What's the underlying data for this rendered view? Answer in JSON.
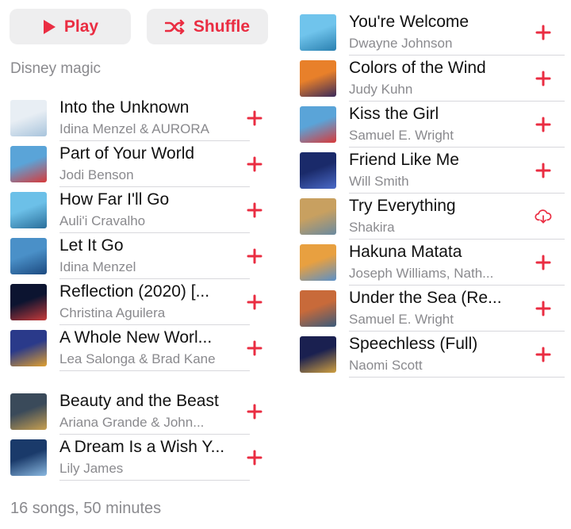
{
  "buttons": {
    "play_label": "Play",
    "shuffle_label": "Shuffle"
  },
  "description": "Disney magic",
  "left_songs": [
    {
      "title": "Into the Unknown",
      "artist": "Idina Menzel & AURORA",
      "art": [
        "#e8eef4",
        "#a8c4dc"
      ],
      "action": "add"
    },
    {
      "title": "Part of Your World",
      "artist": "Jodi Benson",
      "art": [
        "#5aa4d8",
        "#d83a3a"
      ],
      "action": "add"
    },
    {
      "title": "How Far I'll Go",
      "artist": "Auli'i Cravalho",
      "art": [
        "#6cc0e8",
        "#2a6e9a"
      ],
      "action": "add"
    },
    {
      "title": "Let It Go",
      "artist": "Idina Menzel",
      "art": [
        "#4a90c8",
        "#1c4a80"
      ],
      "action": "add"
    },
    {
      "title": "Reflection (2020) [...",
      "artist": "Christina Aguilera",
      "art": [
        "#0c1430",
        "#c83a3a"
      ],
      "action": "add"
    },
    {
      "title": "A Whole New Worl...",
      "artist": "Lea Salonga & Brad Kane",
      "art": [
        "#2a3a8a",
        "#e0a030"
      ],
      "action": "add"
    }
  ],
  "left_songs_more": [
    {
      "title": "Beauty and the Beast",
      "artist": "Ariana Grande & John...",
      "art": [
        "#3a4a5a",
        "#c8a050"
      ],
      "action": "add"
    },
    {
      "title": "A Dream Is a Wish Y...",
      "artist": "Lily James",
      "art": [
        "#1a3a6a",
        "#8ab8e0"
      ],
      "action": "add"
    }
  ],
  "right_songs": [
    {
      "title": "You're Welcome",
      "artist": "Dwayne Johnson",
      "art": [
        "#70c4ec",
        "#2a80b0"
      ],
      "action": "add"
    },
    {
      "title": "Colors of the Wind",
      "artist": "Judy Kuhn",
      "art": [
        "#e8802a",
        "#3a2a5a"
      ],
      "action": "add"
    },
    {
      "title": "Kiss the Girl",
      "artist": "Samuel E. Wright",
      "art": [
        "#5aa4d8",
        "#d83a3a"
      ],
      "action": "add"
    },
    {
      "title": "Friend Like Me",
      "artist": "Will Smith",
      "art": [
        "#1a2a6a",
        "#4a6ac8"
      ],
      "action": "add"
    },
    {
      "title": "Try Everything",
      "artist": "Shakira",
      "art": [
        "#c8a060",
        "#6a8aa0"
      ],
      "action": "download"
    },
    {
      "title": "Hakuna Matata",
      "artist": "Joseph Williams, Nath...",
      "art": [
        "#e8a040",
        "#5a90c8"
      ],
      "action": "add"
    },
    {
      "title": "Under the Sea (Re...",
      "artist": "Samuel E. Wright",
      "art": [
        "#c86a3a",
        "#3a5a7a"
      ],
      "action": "add"
    },
    {
      "title": "Speechless (Full)",
      "artist": "Naomi Scott",
      "art": [
        "#1a2050",
        "#d0a040"
      ],
      "action": "add"
    }
  ],
  "footer": "16 songs, 50 minutes",
  "accent_color": "#ea2d42"
}
